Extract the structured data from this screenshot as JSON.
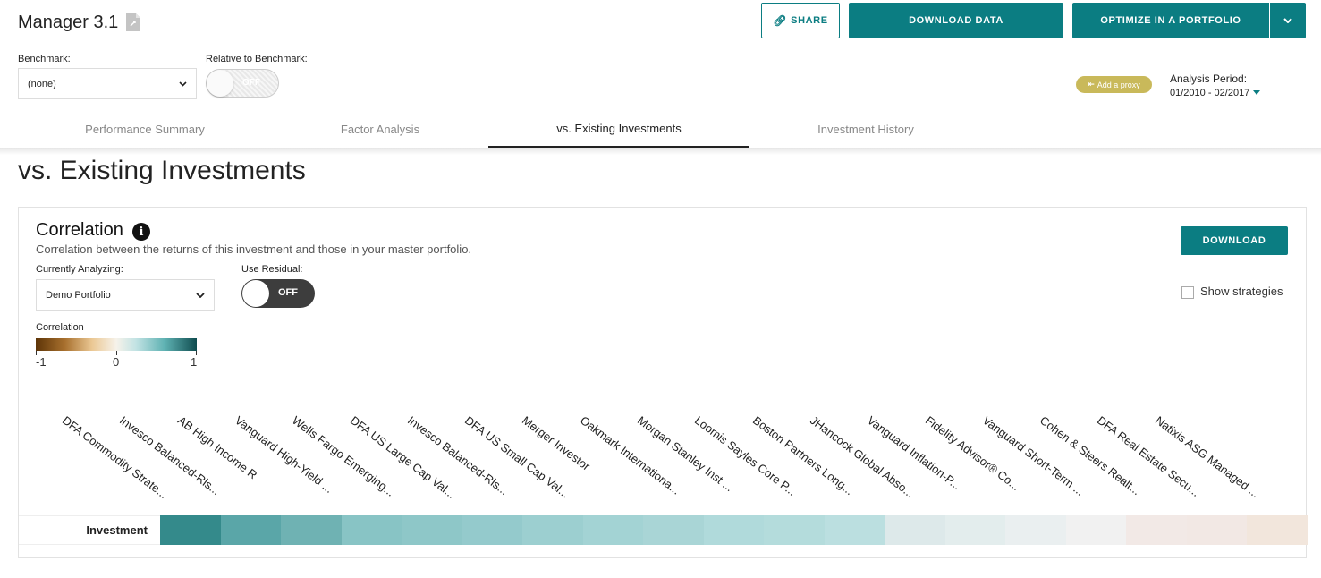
{
  "header": {
    "title": "Manager 3.1",
    "share_label": "SHARE",
    "download_data_label": "DOWNLOAD DATA",
    "optimize_label": "OPTIMIZE IN A PORTFOLIO",
    "benchmark_label": "Benchmark:",
    "benchmark_value": "(none)",
    "relative_label": "Relative to Benchmark:",
    "relative_toggle": "OFF",
    "proxy_label": "Add a proxy",
    "analysis_label": "Analysis Period:",
    "analysis_value": "01/2010 - 02/2017"
  },
  "tabs": [
    {
      "label": "Performance Summary",
      "active": false
    },
    {
      "label": "Factor Analysis",
      "active": false
    },
    {
      "label": "vs. Existing Investments",
      "active": true
    },
    {
      "label": "Investment History",
      "active": false
    }
  ],
  "page_heading": "vs. Existing Investments",
  "card": {
    "title": "Correlation",
    "subtitle": "Correlation between the returns of this investment and those in your master portfolio.",
    "download_label": "DOWNLOAD",
    "analyzing_label": "Currently Analyzing:",
    "analyzing_value": "Demo Portfolio",
    "residual_label": "Use Residual:",
    "residual_toggle": "OFF",
    "show_strategies_label": "Show strategies",
    "legend_title": "Correlation",
    "legend_min": "-1",
    "legend_mid": "0",
    "legend_max": "1",
    "row_label": "Investment",
    "columns": [
      "DFA Commodity Strate...",
      "Invesco Balanced-Ris...",
      "AB High Income R",
      "Vanguard High-Yield ...",
      "Wells Fargo Emerging...",
      "DFA US Large Cap Val...",
      "Invesco Balanced-Ris...",
      "DFA US Small Cap Val...",
      "Merger Investor",
      "Oakmark Internationa...",
      "Morgan Stanley Inst ...",
      "Loomis Sayles Core P...",
      "Boston Partners Long...",
      "JHancock Global Abso...",
      "Vanguard Inflation-P...",
      "Fidelity Advisor® Co...",
      "Vanguard Short-Term ...",
      "Cohen & Steers Realt...",
      "DFA Real Estate Secu...",
      "Natixis ASG Managed ..."
    ],
    "colors": {
      "teal": "#0b7d82",
      "cells": [
        "#348a8b",
        "#5aa6a8",
        "#6fb2b3",
        "#88c4c5",
        "#8ec7c8",
        "#94cacc",
        "#9ccfd0",
        "#a3d3d4",
        "#a9d5d6",
        "#b0dadb",
        "#b4dcdc",
        "#bbdfe0",
        "#dde9ea",
        "#e3eded",
        "#eaeff0",
        "#f1f1f1",
        "#f2e9e6",
        "#f2e8e4",
        "#f2e6dc"
      ]
    }
  }
}
